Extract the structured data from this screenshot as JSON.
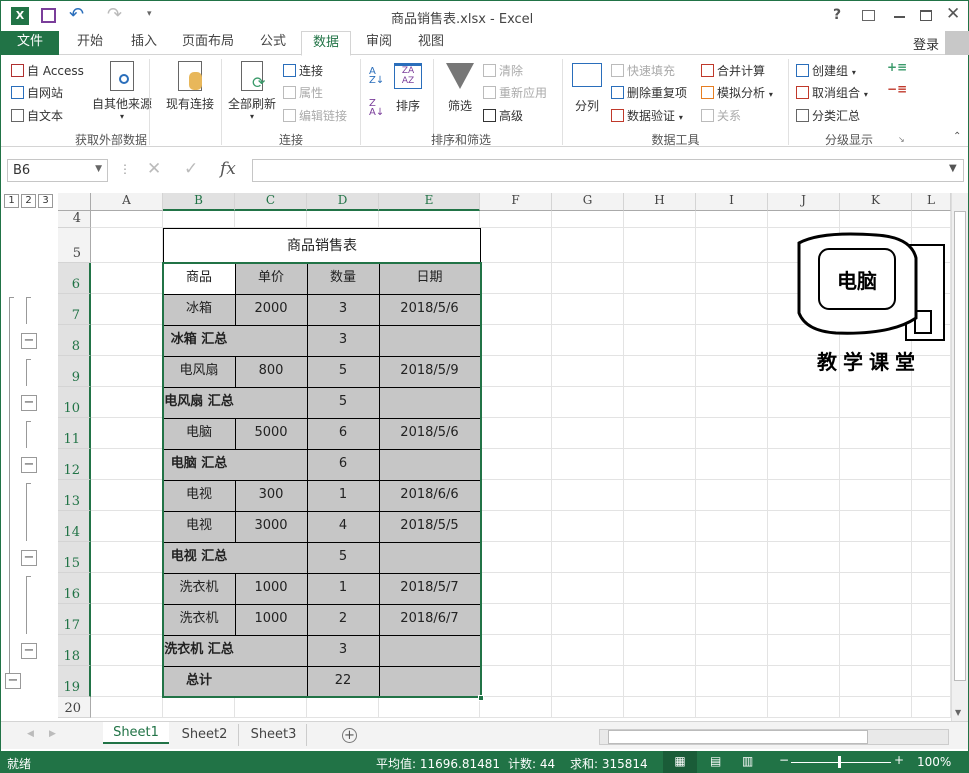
{
  "window": {
    "title": "商品销售表.xlsx - Excel",
    "help": "?",
    "login": "登录"
  },
  "tabs": [
    "文件",
    "开始",
    "插入",
    "页面布局",
    "公式",
    "数据",
    "审阅",
    "视图"
  ],
  "active_tab": "数据",
  "ribbon": {
    "get_external": {
      "access": "自 Access",
      "web": "自网站",
      "text": "自文本",
      "other": "自其他来源",
      "existing": "现有连接",
      "group": "获取外部数据"
    },
    "connections": {
      "refresh_all": "全部刷新",
      "connections": "连接",
      "properties": "属性",
      "edit_links": "编辑链接",
      "group": "连接"
    },
    "sort_filter": {
      "sort": "排序",
      "filter": "筛选",
      "clear": "清除",
      "reapply": "重新应用",
      "advanced": "高级",
      "group": "排序和筛选"
    },
    "data_tools": {
      "text_to_columns": "分列",
      "flash_fill": "快速填充",
      "remove_duplicates": "删除重复项",
      "validation": "数据验证",
      "consolidate": "合并计算",
      "what_if": "模拟分析",
      "relationships": "关系",
      "group": "数据工具"
    },
    "outline": {
      "group_btn": "创建组",
      "ungroup": "取消组合",
      "subtotal": "分类汇总",
      "group": "分级显示"
    }
  },
  "formula_bar": {
    "name_box": "B6",
    "formula": "",
    "fx": "fx"
  },
  "outline_levels": [
    "1",
    "2",
    "3"
  ],
  "columns": [
    "A",
    "B",
    "C",
    "D",
    "E",
    "F",
    "G",
    "H",
    "I",
    "J",
    "K",
    "L"
  ],
  "table_title": "商品销售表",
  "headers": [
    "商品",
    "单价",
    "数量",
    "日期"
  ],
  "rows": [
    {
      "n": "7",
      "type": "item",
      "cells": [
        "冰箱",
        "2000",
        "3",
        "2018/5/6"
      ]
    },
    {
      "n": "8",
      "type": "sub",
      "cells": [
        "冰箱  汇总",
        "",
        "3",
        ""
      ]
    },
    {
      "n": "9",
      "type": "item",
      "cells": [
        "电风扇",
        "800",
        "5",
        "2018/5/9"
      ]
    },
    {
      "n": "10",
      "type": "sub",
      "cells": [
        "电风扇  汇总",
        "",
        "5",
        ""
      ]
    },
    {
      "n": "11",
      "type": "item",
      "cells": [
        "电脑",
        "5000",
        "6",
        "2018/5/6"
      ]
    },
    {
      "n": "12",
      "type": "sub",
      "cells": [
        "电脑  汇总",
        "",
        "6",
        ""
      ]
    },
    {
      "n": "13",
      "type": "item",
      "cells": [
        "电视",
        "300",
        "1",
        "2018/6/6"
      ]
    },
    {
      "n": "14",
      "type": "item",
      "cells": [
        "电视",
        "3000",
        "4",
        "2018/5/5"
      ]
    },
    {
      "n": "15",
      "type": "sub",
      "cells": [
        "电视  汇总",
        "",
        "5",
        ""
      ]
    },
    {
      "n": "16",
      "type": "item",
      "cells": [
        "洗衣机",
        "1000",
        "1",
        "2018/5/7"
      ]
    },
    {
      "n": "17",
      "type": "item",
      "cells": [
        "洗衣机",
        "1000",
        "2",
        "2018/6/7"
      ]
    },
    {
      "n": "18",
      "type": "sub",
      "cells": [
        "洗衣机  汇总",
        "",
        "3",
        ""
      ]
    },
    {
      "n": "19",
      "type": "sub",
      "cells": [
        "总计",
        "",
        "22",
        ""
      ]
    }
  ],
  "logo": {
    "line1": "电脑",
    "line2": "教学课堂"
  },
  "sheets": [
    "Sheet1",
    "Sheet2",
    "Sheet3"
  ],
  "active_sheet": "Sheet1",
  "status": {
    "ready": "就绪",
    "average": "平均值: 11696.81481",
    "count": "计数: 44",
    "sum": "求和: 315814",
    "zoom": "100%"
  },
  "colors": {
    "accent": "#217346",
    "selection": "#c6c6c6"
  }
}
